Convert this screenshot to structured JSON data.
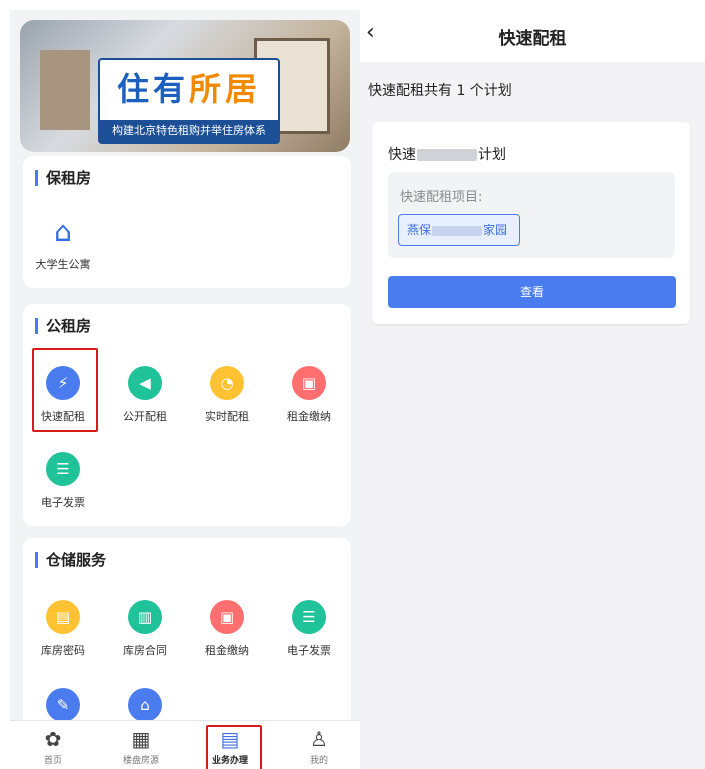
{
  "left": {
    "banner": {
      "title_part1": "住有",
      "title_part2": "所居",
      "subtitle": "构建北京特色租购并举住房体系"
    },
    "sections": [
      {
        "title": "保租房",
        "apps": [
          {
            "label": "大学生公寓",
            "icon": "house-key-icon",
            "color": "#2f6fe0"
          }
        ]
      },
      {
        "title": "公租房",
        "apps": [
          {
            "label": "快速配租",
            "icon": "lightning-icon",
            "color": "#4a7cf0"
          },
          {
            "label": "公开配租",
            "icon": "megaphone-icon",
            "color": "#20c29a"
          },
          {
            "label": "实时配租",
            "icon": "clock-icon",
            "color": "#ffc233"
          },
          {
            "label": "租金缴纳",
            "icon": "wallet-icon",
            "color": "#ff6f6f"
          },
          {
            "label": "电子发票",
            "icon": "invoice-icon",
            "color": "#20c29a"
          }
        ]
      },
      {
        "title": "仓储服务",
        "apps": [
          {
            "label": "库房密码",
            "icon": "lock-folder-icon",
            "color": "#ffc233"
          },
          {
            "label": "库房合同",
            "icon": "contract-icon",
            "color": "#20c29a"
          },
          {
            "label": "租金缴纳",
            "icon": "wallet-icon",
            "color": "#ff6f6f"
          },
          {
            "label": "电子发票",
            "icon": "invoice-icon",
            "color": "#20c29a"
          },
          {
            "label": "",
            "icon": "edit-icon",
            "color": "#4a7cf0"
          },
          {
            "label": "",
            "icon": "home-icon",
            "color": "#4a7cf0"
          }
        ]
      }
    ],
    "tabbar": [
      {
        "label": "首页",
        "icon": "home-logo-icon"
      },
      {
        "label": "楼盘房源",
        "icon": "building-icon"
      },
      {
        "label": "业务办理",
        "icon": "document-icon",
        "active": true
      },
      {
        "label": "我的",
        "icon": "user-icon"
      }
    ]
  },
  "right": {
    "back_icon": "chevron-left-icon",
    "title": "快速配租",
    "summary": "快速配租共有 1 个计划",
    "plan": {
      "name_prefix": "快速",
      "name_suffix": "计划",
      "project_label": "快速配租项目:",
      "project_prefix": "燕保",
      "project_suffix": "家园",
      "view_button": "查看"
    }
  },
  "colors": {
    "accent": "#4a7cf0",
    "highlight": "#d71a1a"
  }
}
